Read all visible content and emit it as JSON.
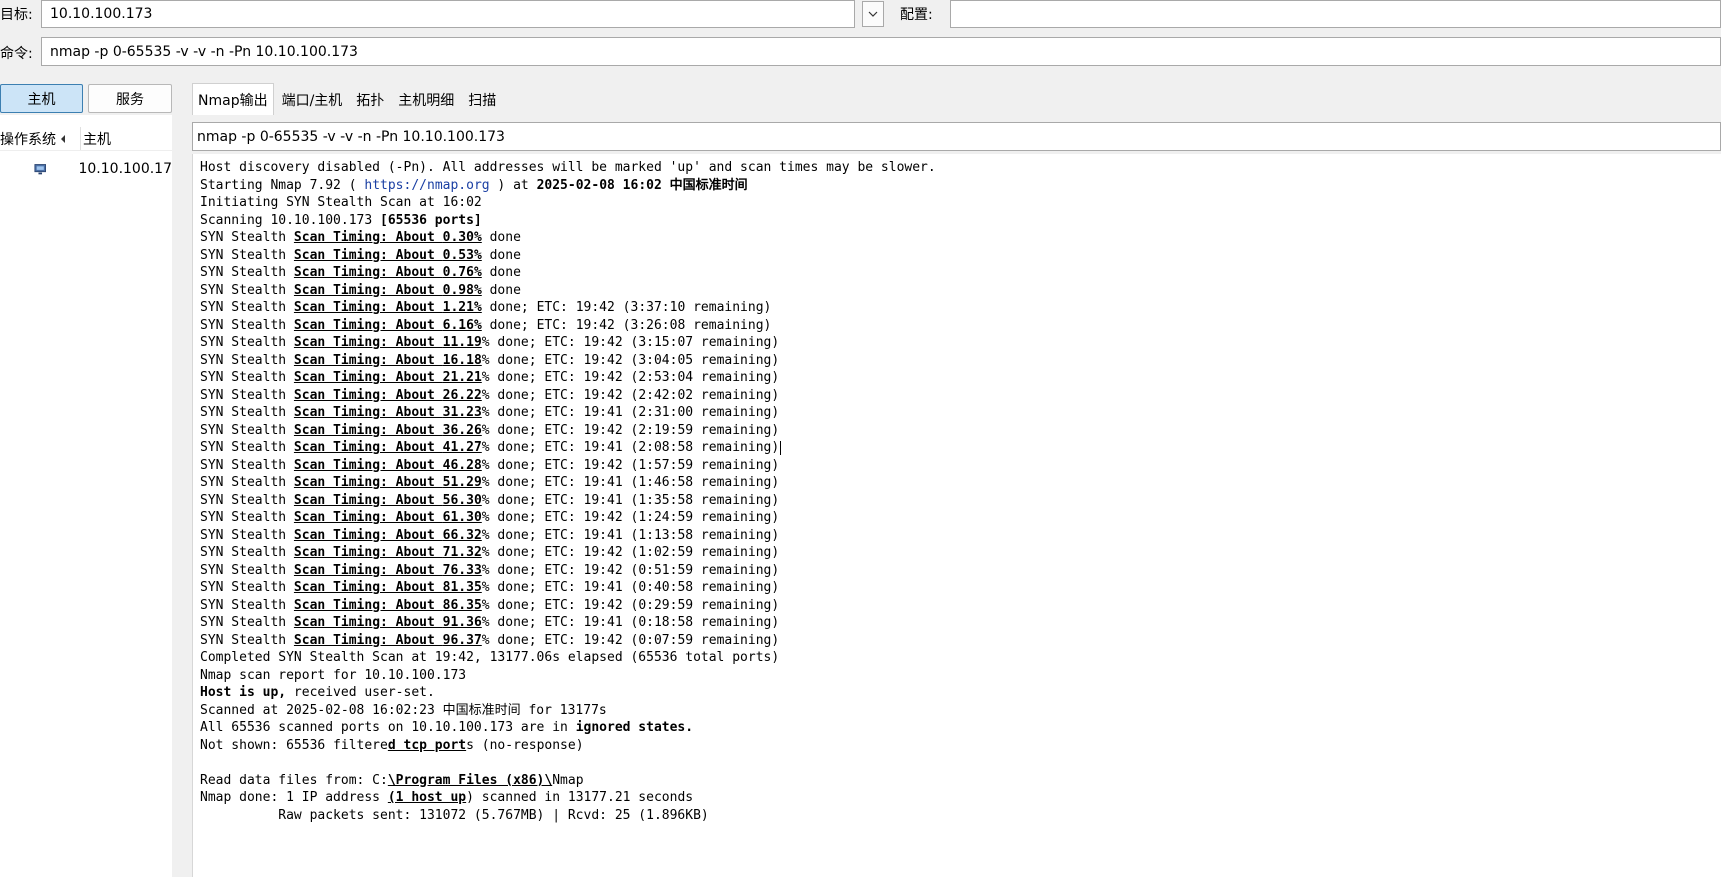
{
  "top": {
    "target_label": "目标:",
    "target_value": "10.10.100.173",
    "profile_label": "配置:",
    "profile_value": "",
    "command_label": "命令:",
    "command_value": "nmap -p 0-65535 -v -v -n -Pn 10.10.100.173"
  },
  "left": {
    "hosts_button": "主机",
    "services_button": "服务",
    "col_os": "操作系统",
    "col_host": "主机",
    "hosts": [
      {
        "ip": "10.10.100.17"
      }
    ]
  },
  "tabs": [
    "Nmap输出",
    "端口/主机",
    "拓扑",
    "主机明细",
    "扫描"
  ],
  "output": {
    "command": "nmap -p 0-65535 -v -v -n -Pn 10.10.100.173",
    "line1": "Host discovery disabled (-Pn). All addresses will be marked 'up' and scan times may be slower.",
    "starting_pre": "Starting Nmap 7.92 ( ",
    "starting_url": "https://nmap.org",
    "starting_mid": " ) at ",
    "starting_time": "2025-02-08 16:02 中国标准时间",
    "initiating": "Initiating SYN Stealth Scan at 16:02",
    "scanning_pre": "Scanning 10.10.100.173 ",
    "scanning_ports": "[65536 ports]",
    "timing_prefix": "SYN Stealth ",
    "timing_label": "Scan Timing: About ",
    "timing_lines": [
      {
        "pct": "0.30%",
        "rest": " done"
      },
      {
        "pct": "0.53%",
        "rest": " done"
      },
      {
        "pct": "0.76%",
        "rest": " done"
      },
      {
        "pct": "0.98%",
        "rest": " done"
      },
      {
        "pct": "1.21%",
        "rest": " done; ETC: 19:42 (3:37:10 remaining)"
      },
      {
        "pct": "6.16%",
        "rest": " done; ETC: 19:42 (3:26:08 remaining)"
      },
      {
        "pct": "11.19",
        "rest": "% done; ETC: 19:42 (3:15:07 remaining)"
      },
      {
        "pct": "16.18",
        "rest": "% done; ETC: 19:42 (3:04:05 remaining)"
      },
      {
        "pct": "21.21",
        "rest": "% done; ETC: 19:42 (2:53:04 remaining)"
      },
      {
        "pct": "26.22",
        "rest": "% done; ETC: 19:42 (2:42:02 remaining)"
      },
      {
        "pct": "31.23",
        "rest": "% done; ETC: 19:41 (2:31:00 remaining)"
      },
      {
        "pct": "36.26",
        "rest": "% done; ETC: 19:42 (2:19:59 remaining)"
      },
      {
        "pct": "41.27",
        "rest": "% done; ETC: 19:41 (2:08:58 remaining)"
      },
      {
        "pct": "46.28",
        "rest": "% done; ETC: 19:42 (1:57:59 remaining)"
      },
      {
        "pct": "51.29",
        "rest": "% done; ETC: 19:41 (1:46:58 remaining)"
      },
      {
        "pct": "56.30",
        "rest": "% done; ETC: 19:41 (1:35:58 remaining)"
      },
      {
        "pct": "61.30",
        "rest": "% done; ETC: 19:42 (1:24:59 remaining)"
      },
      {
        "pct": "66.32",
        "rest": "% done; ETC: 19:41 (1:13:58 remaining)"
      },
      {
        "pct": "71.32",
        "rest": "% done; ETC: 19:42 (1:02:59 remaining)"
      },
      {
        "pct": "76.33",
        "rest": "% done; ETC: 19:42 (0:51:59 remaining)"
      },
      {
        "pct": "81.35",
        "rest": "% done; ETC: 19:41 (0:40:58 remaining)"
      },
      {
        "pct": "86.35",
        "rest": "% done; ETC: 19:42 (0:29:59 remaining)"
      },
      {
        "pct": "91.36",
        "rest": "% done; ETC: 19:41 (0:18:58 remaining)"
      },
      {
        "pct": "96.37",
        "rest": "% done; ETC: 19:42 (0:07:59 remaining)"
      }
    ],
    "completed": "Completed SYN Stealth Scan at 19:42, 13177.06s elapsed (65536 total ports)",
    "report": "Nmap scan report for 10.10.100.173",
    "host_up_bold": "Host is up,",
    "host_up_rest": " received user-set.",
    "scanned_pre": "Scanned at 2025-02-08 16:02:23 中国标准时间 for 13177s",
    "all_pre": "All 65536 scanned ports on 10.10.100.173 are in ",
    "all_bold": "ignored states.",
    "not_shown_pre": "Not shown: 65536 filtere",
    "not_shown_u": "d tcp port",
    "not_shown_post": "s (no-response)",
    "read_pre": "Read data files from: C:",
    "read_u": "\\Program Files (x86)\\",
    "read_post": "Nmap",
    "done_pre": "Nmap done: 1 IP address ",
    "done_u": "(1 host up",
    "done_post": ") scanned in 13177.21 seconds",
    "raw": "          Raw packets sent: 131072 (5.767MB) | Rcvd: 25 (1.896KB)"
  }
}
